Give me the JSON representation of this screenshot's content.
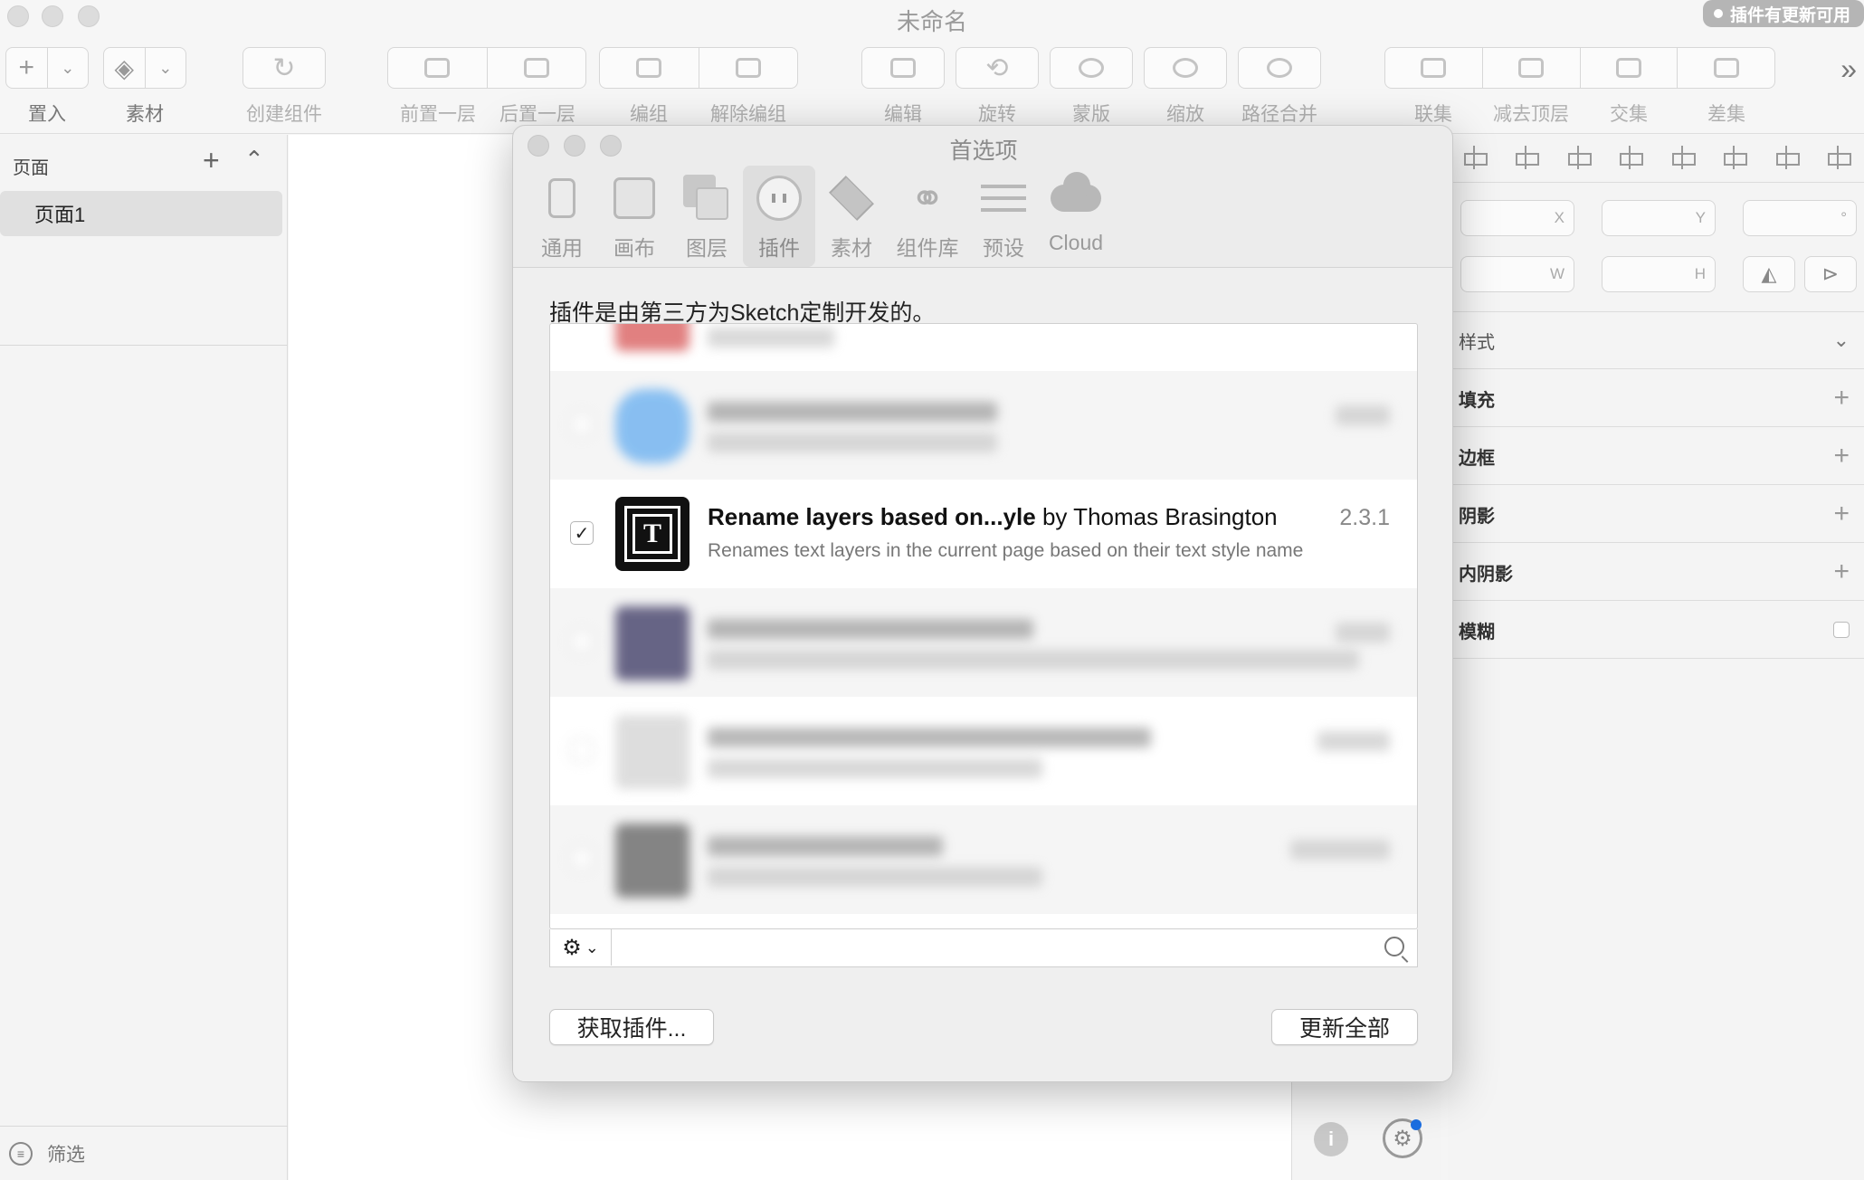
{
  "window": {
    "title": "未命名",
    "update_badge": "插件有更新可用"
  },
  "toolbar": {
    "insert": "置入",
    "assets": "素材",
    "create_symbol": "创建组件",
    "forward": "前置一层",
    "backward": "后置一层",
    "group": "编组",
    "ungroup": "解除编组",
    "edit": "编辑",
    "rotate": "旋转",
    "mask": "蒙版",
    "scale": "缩放",
    "flatten": "路径合并",
    "union": "联集",
    "subtract": "减去顶层",
    "intersect": "交集",
    "difference": "差集"
  },
  "sidebar": {
    "pages_header": "页面",
    "pages": [
      "页面1"
    ],
    "filter_label": "筛选"
  },
  "inspector": {
    "x_label": "X",
    "y_label": "Y",
    "angle_label": "°",
    "w_label": "W",
    "h_label": "H",
    "style_label": "样式",
    "fill_label": "填充",
    "border_label": "边框",
    "shadow_label": "阴影",
    "inner_shadow_label": "内阴影",
    "blur_label": "模糊"
  },
  "dialog": {
    "title": "首选项",
    "tabs": [
      {
        "label": "通用",
        "icon": "phone-icon"
      },
      {
        "label": "画布",
        "icon": "canvas-icon"
      },
      {
        "label": "图层",
        "icon": "layers-icon"
      },
      {
        "label": "插件",
        "icon": "plug-icon"
      },
      {
        "label": "素材",
        "icon": "assets-icon"
      },
      {
        "label": "组件库",
        "icon": "link-icon"
      },
      {
        "label": "预设",
        "icon": "sliders-icon"
      },
      {
        "label": "Cloud",
        "icon": "cloud-icon"
      }
    ],
    "active_tab": "插件",
    "intro": "插件是由第三方为Sketch定制开发的。",
    "plugin": {
      "name": "Rename layers based on...yle",
      "by": "by Thomas Brasington",
      "version": "2.3.1",
      "description": "Renames text layers in the current page based on their text style name",
      "enabled": true
    },
    "get_plugins": "获取插件...",
    "update_all": "更新全部"
  }
}
